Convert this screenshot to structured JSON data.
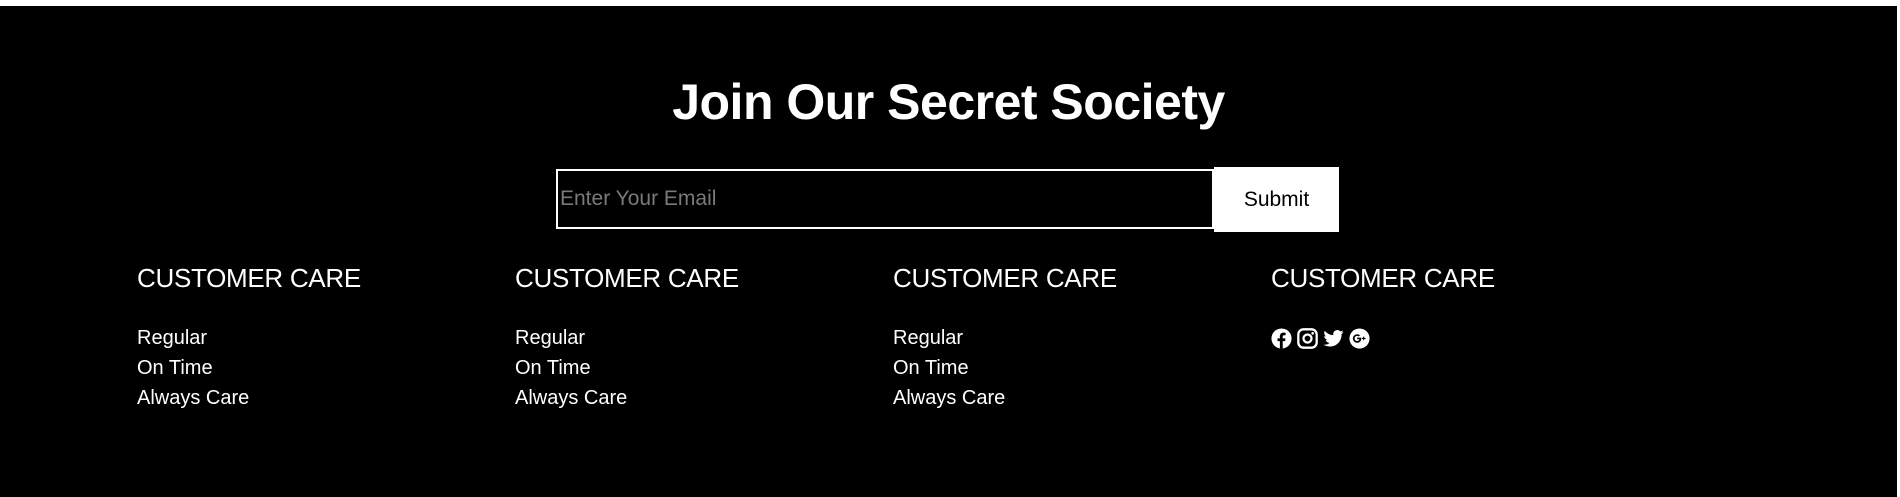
{
  "newsletter": {
    "heading": "Join Our Secret Society",
    "email_placeholder": "Enter Your Email",
    "submit_label": "Submit"
  },
  "columns": [
    {
      "title": "CUSTOMER CARE",
      "links": [
        "Regular",
        "On Time",
        "Always Care"
      ]
    },
    {
      "title": "CUSTOMER CARE",
      "links": [
        "Regular",
        "On Time",
        "Always Care"
      ]
    },
    {
      "title": "CUSTOMER CARE",
      "links": [
        "Regular",
        "On Time",
        "Always Care"
      ]
    },
    {
      "title": "CUSTOMER CARE",
      "social_icons": [
        "facebook-icon",
        "instagram-icon",
        "twitter-icon",
        "google-plus-icon"
      ]
    }
  ],
  "colors": {
    "background": "#000000",
    "text": "#ffffff",
    "placeholder": "#7a7a7a",
    "button_background": "#ffffff",
    "button_text": "#000000"
  }
}
